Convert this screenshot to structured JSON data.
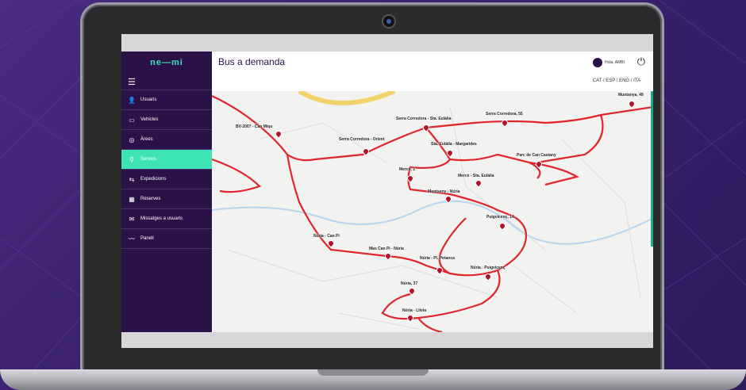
{
  "app": {
    "logo": "ne—mi",
    "title": "Bus a demanda",
    "user_greeting": "Hola, AMBI",
    "languages": "CAT / ESP / ENG / ITA"
  },
  "sidebar": {
    "items": [
      {
        "label": "Usuaris",
        "icon": "user-icon"
      },
      {
        "label": "Vehicles",
        "icon": "bus-icon"
      },
      {
        "label": "Àrees",
        "icon": "area-icon"
      },
      {
        "label": "Serveis",
        "icon": "route-icon",
        "active": true
      },
      {
        "label": "Expedicions",
        "icon": "expeditions-icon"
      },
      {
        "label": "Reserves",
        "icon": "calendar-icon"
      },
      {
        "label": "Missatges a usuaris",
        "icon": "mail-icon"
      },
      {
        "label": "Panell",
        "icon": "chart-icon"
      }
    ]
  },
  "map": {
    "route_color": "#e0262b",
    "stops": [
      {
        "label": "Muntanya, 49"
      },
      {
        "label": "Serra Corredora, 55"
      },
      {
        "label": "Serra Corredora - Sta. Eulàlia"
      },
      {
        "label": "BV-2007 - Can Miqu"
      },
      {
        "label": "Serra Corredora - Orient"
      },
      {
        "label": "Sta. Eulàlia - Margarides"
      },
      {
        "label": "Parc de Can Castany"
      },
      {
        "label": "Mercè, 1"
      },
      {
        "label": "Mercè - Sta. Eulàlia"
      },
      {
        "label": "Montseny - Núria"
      },
      {
        "label": "Puigvicenç, 14"
      },
      {
        "label": "Núria - Can Pi"
      },
      {
        "label": "Mas Can Pi - Núria"
      },
      {
        "label": "Núria - Pl. Petanca"
      },
      {
        "label": "Núria - Puigvicenç"
      },
      {
        "label": "Núria, 37"
      },
      {
        "label": "Núria - Llívia"
      }
    ]
  }
}
